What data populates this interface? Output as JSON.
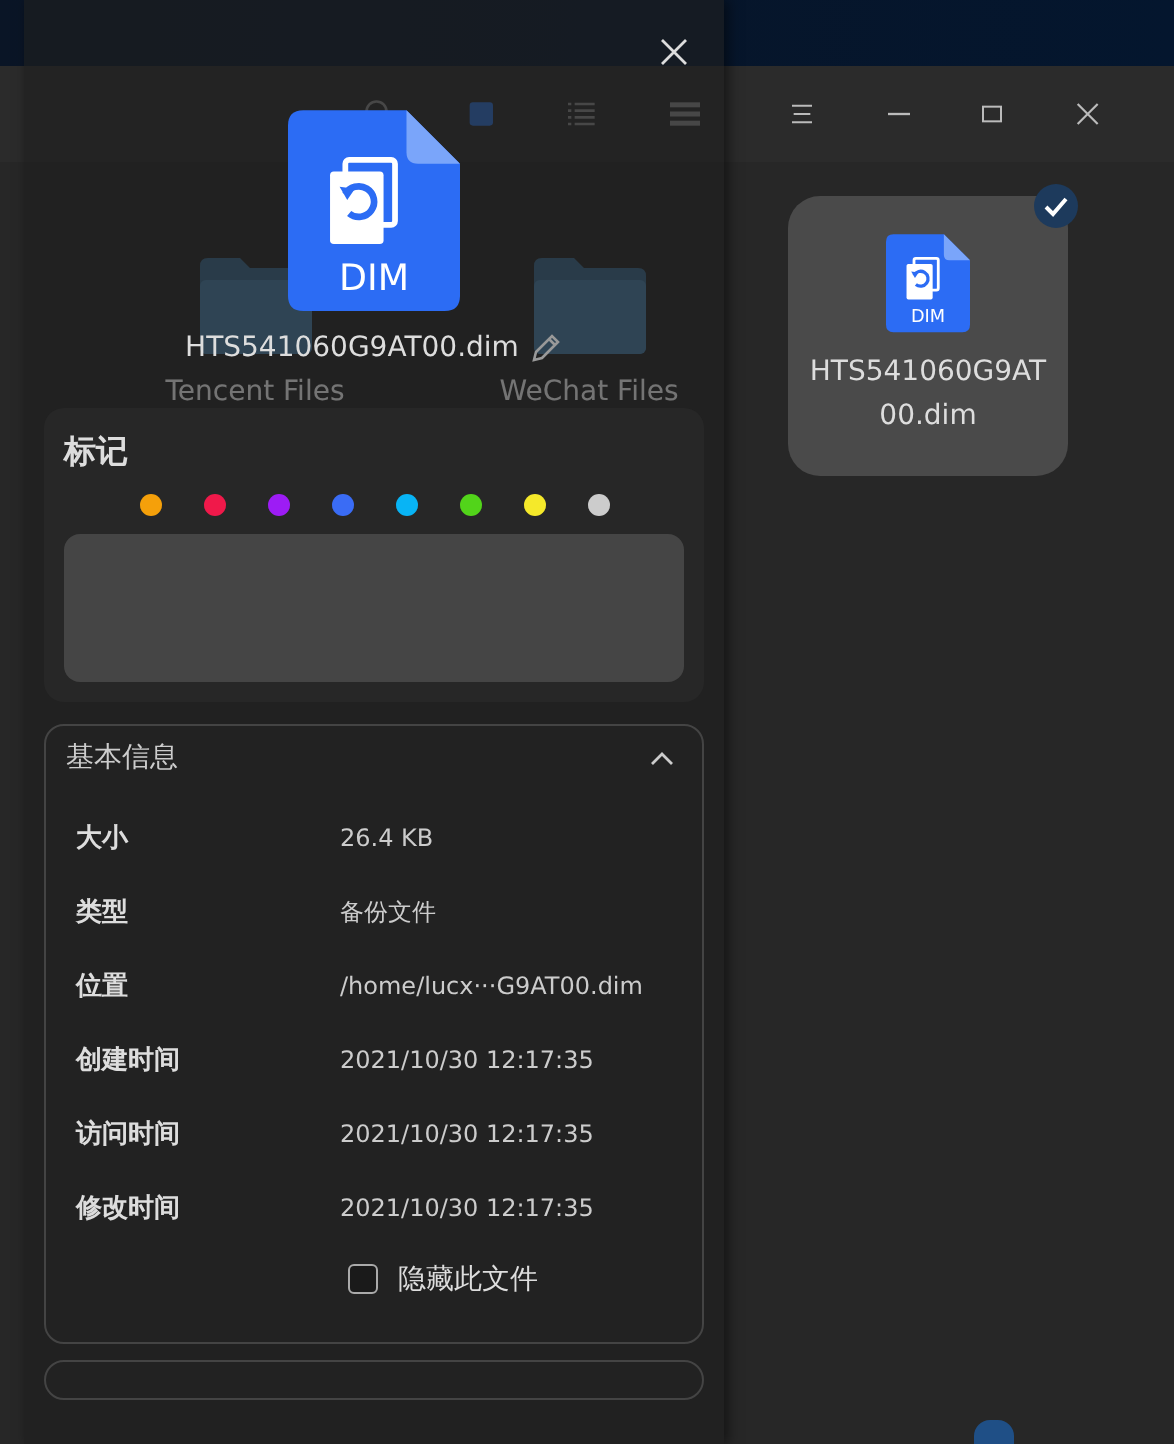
{
  "file_manager": {
    "folders": [
      {
        "name": "Tencent Files"
      },
      {
        "name": "WeChat Files"
      }
    ],
    "files": [
      {
        "name": "HTS541060G9AT00.dim",
        "icon_label": "DIM",
        "selected": true
      }
    ]
  },
  "dialog": {
    "file_name": "HTS541060G9AT00.dim",
    "icon_label": "DIM",
    "tags": {
      "title": "标记",
      "colors": [
        {
          "color": "#f5a00a"
        },
        {
          "color": "#f0194a"
        },
        {
          "color": "#9d1cf5"
        },
        {
          "color": "#3a6cf5"
        },
        {
          "color": "#08b4f5"
        },
        {
          "color": "#52d41a"
        },
        {
          "color": "#f5e92a"
        },
        {
          "color": "#cccccc"
        }
      ]
    },
    "basic_info": {
      "title": "基本信息",
      "expanded": true,
      "rows": [
        {
          "label": "大小",
          "value": "26.4 KB"
        },
        {
          "label": "类型",
          "value": "备份文件"
        },
        {
          "label": "位置",
          "value": "/home/lucx···G9AT00.dim"
        },
        {
          "label": "创建时间",
          "value": "2021/10/30 12:17:35"
        },
        {
          "label": "访问时间",
          "value": "2021/10/30 12:17:35"
        },
        {
          "label": "修改时间",
          "value": "2021/10/30 12:17:35"
        }
      ],
      "hide_file": {
        "label": "隐藏此文件",
        "checked": false
      }
    }
  }
}
